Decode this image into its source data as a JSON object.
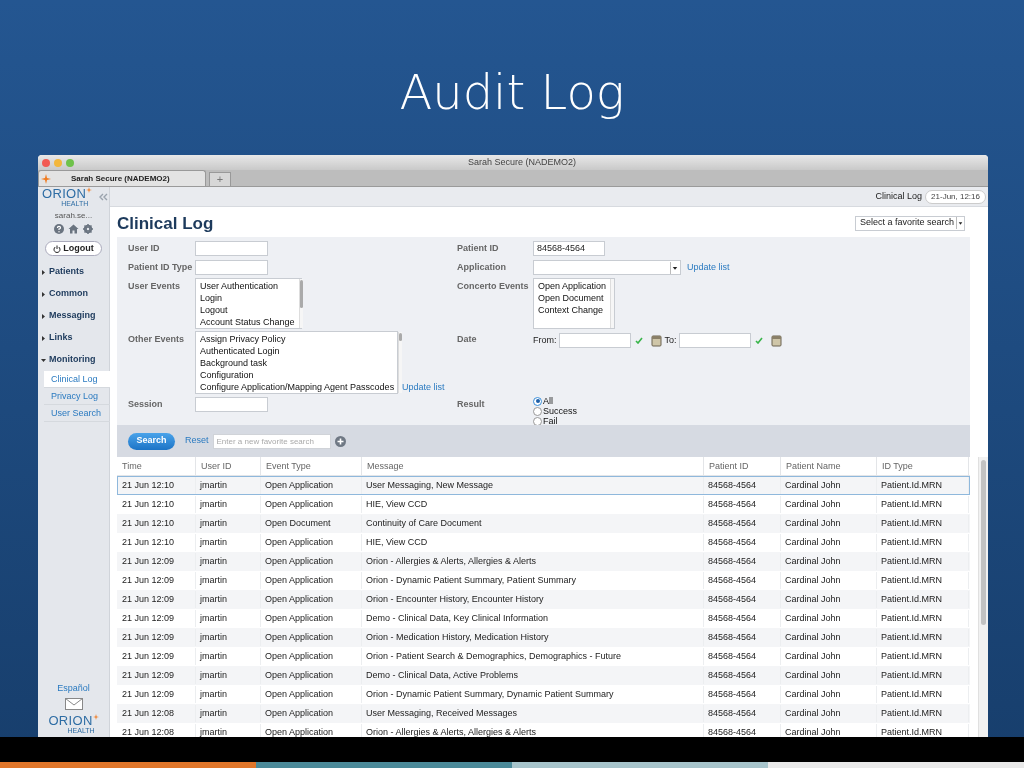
{
  "slide": {
    "title": "Audit Log"
  },
  "window": {
    "title": "Sarah Secure (NADEMO2)",
    "tab": "Sarah Secure (NADEMO2)",
    "new_tab": "+"
  },
  "sidebar": {
    "logo": "ORION",
    "logo_sub": "HEALTH",
    "user": "sarah.se...",
    "logout": "Logout",
    "nav": [
      {
        "label": "Patients",
        "expanded": false
      },
      {
        "label": "Common",
        "expanded": false
      },
      {
        "label": "Messaging",
        "expanded": false
      },
      {
        "label": "Links",
        "expanded": false
      },
      {
        "label": "Monitoring",
        "expanded": true,
        "children": [
          {
            "label": "Clinical Log",
            "selected": true
          },
          {
            "label": "Privacy Log",
            "selected": false
          },
          {
            "label": "User Search",
            "selected": false
          }
        ]
      }
    ],
    "language": "Español",
    "footer_logo": "ORION",
    "footer_logo_sub": "HEALTH"
  },
  "header": {
    "page": "Clinical Log",
    "datetime": "21-Jun, 12:16"
  },
  "content": {
    "title": "Clinical Log",
    "favorite_select": "Select a favorite search"
  },
  "form": {
    "rows": [
      {
        "left": {
          "kind": "input",
          "label": "User ID"
        },
        "right": {
          "kind": "input",
          "label": "Patient ID",
          "value": "84568-4564"
        }
      },
      {
        "left": {
          "kind": "input",
          "label": "Patient ID Type"
        },
        "right": {
          "kind": "select",
          "label": "Application",
          "link": "Update list"
        }
      },
      {
        "left": {
          "kind": "listbox",
          "label": "User Events",
          "options": [
            "User Authentication",
            "Login",
            "Logout",
            "Account Status Change"
          ]
        },
        "right": {
          "kind": "listbox",
          "label": "Concerto Events",
          "options": [
            "Open Application",
            "Open Document",
            "Context Change"
          ]
        }
      },
      {
        "left": {
          "kind": "listbox",
          "label": "Other Events",
          "options": [
            "Assign Privacy Policy",
            "Authenticated Login",
            "Background task",
            "Configuration",
            "Configure Application/Mapping Agent Passcodes"
          ],
          "link": "Update list"
        },
        "right": {
          "kind": "date",
          "label": "Date",
          "from": "From:",
          "to": "To:"
        }
      },
      {
        "left": {
          "kind": "input",
          "label": "Session"
        },
        "right": {
          "kind": "radio",
          "label": "Result",
          "options": [
            {
              "label": "All",
              "selected": true
            },
            {
              "label": "Success",
              "selected": false
            },
            {
              "label": "Fail",
              "selected": false
            }
          ]
        }
      }
    ]
  },
  "search_bar": {
    "button": "Search",
    "reset": "Reset",
    "favorite_placeholder": "Enter a new favorite search"
  },
  "table": {
    "columns": [
      "Time",
      "User ID",
      "Event Type",
      "Message",
      "Patient ID",
      "Patient Name",
      "ID Type"
    ],
    "rows": [
      {
        "selected": true,
        "cells": [
          "21 Jun 12:10",
          "jmartin",
          "Open Application",
          "User Messaging, New Message",
          "84568-4564",
          "Cardinal John",
          "Patient.Id.MRN"
        ]
      },
      {
        "selected": false,
        "cells": [
          "21 Jun 12:10",
          "jmartin",
          "Open Application",
          "HIE, View CCD",
          "84568-4564",
          "Cardinal John",
          "Patient.Id.MRN"
        ]
      },
      {
        "selected": false,
        "cells": [
          "21 Jun 12:10",
          "jmartin",
          "Open Document",
          "Continuity of Care Document",
          "84568-4564",
          "Cardinal John",
          "Patient.Id.MRN"
        ]
      },
      {
        "selected": false,
        "cells": [
          "21 Jun 12:10",
          "jmartin",
          "Open Application",
          "HIE, View CCD",
          "84568-4564",
          "Cardinal John",
          "Patient.Id.MRN"
        ]
      },
      {
        "selected": false,
        "cells": [
          "21 Jun 12:09",
          "jmartin",
          "Open Application",
          "Orion - Allergies & Alerts, Allergies & Alerts",
          "84568-4564",
          "Cardinal John",
          "Patient.Id.MRN"
        ]
      },
      {
        "selected": false,
        "cells": [
          "21 Jun 12:09",
          "jmartin",
          "Open Application",
          "Orion - Dynamic Patient Summary, Patient Summary",
          "84568-4564",
          "Cardinal John",
          "Patient.Id.MRN"
        ]
      },
      {
        "selected": false,
        "cells": [
          "21 Jun 12:09",
          "jmartin",
          "Open Application",
          "Orion - Encounter History, Encounter History",
          "84568-4564",
          "Cardinal John",
          "Patient.Id.MRN"
        ]
      },
      {
        "selected": false,
        "cells": [
          "21 Jun 12:09",
          "jmartin",
          "Open Application",
          "Demo - Clinical Data, Key Clinical Information",
          "84568-4564",
          "Cardinal John",
          "Patient.Id.MRN"
        ]
      },
      {
        "selected": false,
        "cells": [
          "21 Jun 12:09",
          "jmartin",
          "Open Application",
          "Orion - Medication History, Medication History",
          "84568-4564",
          "Cardinal John",
          "Patient.Id.MRN"
        ]
      },
      {
        "selected": false,
        "cells": [
          "21 Jun 12:09",
          "jmartin",
          "Open Application",
          "Orion - Patient Search & Demographics, Demographics - Future",
          "84568-4564",
          "Cardinal John",
          "Patient.Id.MRN"
        ]
      },
      {
        "selected": false,
        "cells": [
          "21 Jun 12:09",
          "jmartin",
          "Open Application",
          "Demo - Clinical Data, Active Problems",
          "84568-4564",
          "Cardinal John",
          "Patient.Id.MRN"
        ]
      },
      {
        "selected": false,
        "cells": [
          "21 Jun 12:09",
          "jmartin",
          "Open Application",
          "Orion - Dynamic Patient Summary, Dynamic Patient Summary",
          "84568-4564",
          "Cardinal John",
          "Patient.Id.MRN"
        ]
      },
      {
        "selected": false,
        "cells": [
          "21 Jun 12:08",
          "jmartin",
          "Open Application",
          "User Messaging, Received Messages",
          "84568-4564",
          "Cardinal John",
          "Patient.Id.MRN"
        ]
      },
      {
        "selected": false,
        "cells": [
          "21 Jun 12:08",
          "jmartin",
          "Open Application",
          "Orion - Allergies & Alerts, Allergies & Alerts",
          "84568-4564",
          "Cardinal John",
          "Patient.Id.MRN"
        ]
      }
    ]
  }
}
